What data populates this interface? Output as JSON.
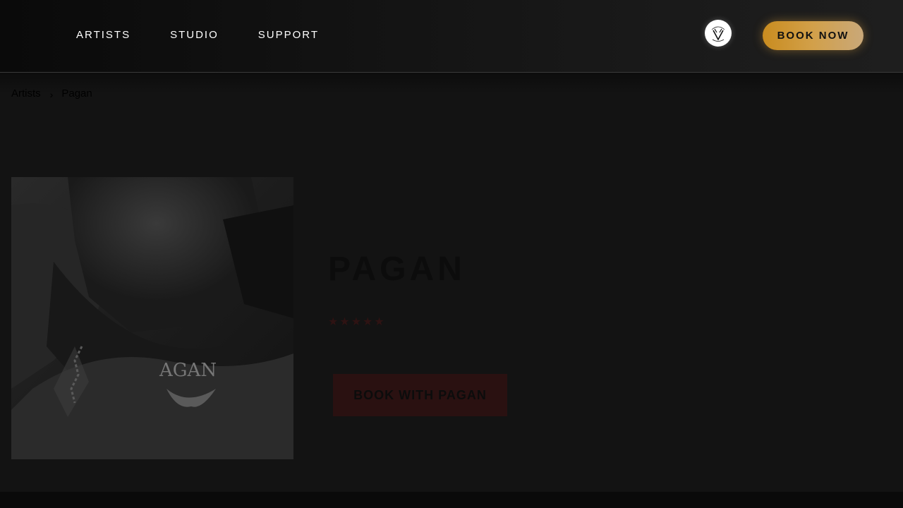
{
  "header": {
    "nav": [
      {
        "label": "ARTISTS"
      },
      {
        "label": "STUDIO"
      },
      {
        "label": "SUPPORT"
      }
    ],
    "logo_icon": "studio-logo-icon",
    "book_now_label": "BOOK NOW",
    "accent_color": "#d2a04a"
  },
  "breadcrumb": {
    "items": [
      "Artists",
      "Pagan"
    ],
    "separator": "›"
  },
  "artist": {
    "name": "PAGAN",
    "rating_stars": 5,
    "book_label": "BOOK WITH PAGAN",
    "photo_text": "AGAN",
    "button_color": "#2a1111"
  },
  "colors": {
    "background": "#131313",
    "header": "#141414",
    "book_now_gradient_start": "#c98c1f",
    "book_now_gradient_end": "#c9a879"
  }
}
